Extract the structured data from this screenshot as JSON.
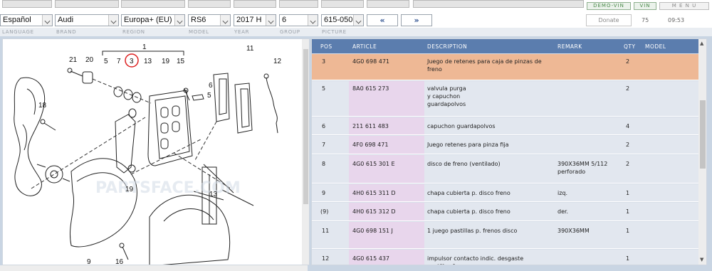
{
  "topbar": {
    "demo_vin": "DEMO-VIN",
    "vin": "VIN",
    "menu": "M E N U"
  },
  "selectors": {
    "language": "Español",
    "brand": "Audi",
    "region": "Europa+ (EU)",
    "model": "RS6",
    "year": "2017  H",
    "group": "6",
    "picture": "615-050",
    "prev": "«",
    "next": "»",
    "donate": "Donate",
    "count": "75",
    "time": "09:53"
  },
  "labels": {
    "language": "LANGUAGE",
    "brand": "BRAND",
    "region": "REGION",
    "model": "MODEL",
    "year": "YEAR",
    "group": "GROUP",
    "picture": "PICTURE"
  },
  "diagram": {
    "callouts": [
      "1",
      "21",
      "20",
      "5",
      "7",
      "3",
      "13",
      "19",
      "15",
      "11",
      "12",
      "6",
      "5",
      "18",
      "19",
      "13",
      "9",
      "16"
    ],
    "watermark": "PARTSFACE.COM"
  },
  "parts": {
    "headers": {
      "pos": "POS",
      "article": "ARTICLE",
      "description": "DESCRIPTION",
      "remark": "REMARK",
      "qty": "QTY",
      "model": "MODEL"
    },
    "rows": [
      {
        "pos": "3",
        "article": "4G0 698 471",
        "description": "Juego de retenes para caja de pinzas de freno",
        "remark": "",
        "qty": "2",
        "selected": true
      },
      {
        "pos": "5",
        "article": "8A0 615 273",
        "description": "valvula purga y capuchon guardapolvos",
        "remark": "",
        "qty": "2",
        "selected": false
      },
      {
        "pos": "6",
        "article": "211 611 483",
        "description": "capuchon guardapolvos",
        "remark": "",
        "qty": "4",
        "selected": false
      },
      {
        "pos": "7",
        "article": "4F0 698 471",
        "description": "Juego retenes para pinza fija",
        "remark": "",
        "qty": "2",
        "selected": false
      },
      {
        "pos": "8",
        "article": "4G0 615 301 E",
        "description": "disco de freno (ventilado)",
        "remark": "390X36MM 5/112 perforado",
        "qty": "2",
        "selected": false
      },
      {
        "pos": "9",
        "article": "4H0 615 311 D",
        "description": "chapa cubierta p. disco freno",
        "remark": "izq.",
        "qty": "1",
        "selected": false
      },
      {
        "pos": "(9)",
        "article": "4H0 615 312 D",
        "description": "chapa cubierta p. disco freno",
        "remark": "der.",
        "qty": "1",
        "selected": false
      },
      {
        "pos": "11",
        "article": "4G0 698 151 J",
        "description": "1 juego pastillas p. frenos disco",
        "remark": "390X36MM",
        "qty": "1",
        "selected": false
      },
      {
        "pos": "12",
        "article": "4G0 615 437",
        "description": "impulsor contacto indic. desgaste pastillas freno",
        "remark": "",
        "qty": "1",
        "selected": false
      }
    ]
  },
  "colors": {
    "header_bg": "#5b7dae",
    "selected_row": "#eeb895",
    "article_col": "#e8d6ec",
    "row_bg": "#e2e7ef"
  }
}
